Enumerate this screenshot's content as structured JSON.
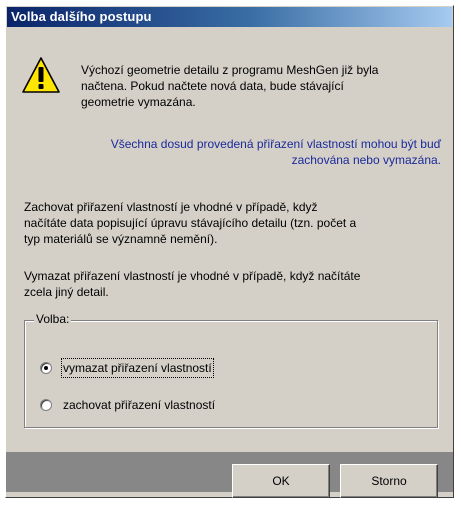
{
  "window": {
    "title": "Volba dalšího postupu"
  },
  "icons": {
    "warning": "warning-icon"
  },
  "messages": {
    "intro_line1": "Výchozí geometrie detailu z programu MeshGen již byla",
    "intro_line2": "načtena. Pokud načtete nová data, bude stávající",
    "intro_line3": "geometrie vymazána.",
    "info_line1": "Všechna dosud provedená přiřazení vlastností mohou být buď",
    "info_line2": "zachována nebo vymazána.",
    "keep_line1": "Zachovat přiřazení vlastností je vhodné v případě, když",
    "keep_line2": "načítáte data popisující úpravu stávajícího detailu (tzn. počet a",
    "keep_line3": "typ materiálů se významně nemění).",
    "delete_line1": "Vymazat přiřazení vlastností je vhodné v případě, když načítáte",
    "delete_line2": "zcela jiný detail."
  },
  "choice_group": {
    "legend": "Volba:",
    "options": [
      {
        "label": "vymazat přiřazení vlastností",
        "selected": true
      },
      {
        "label": "zachovat přiřazení vlastností",
        "selected": false
      }
    ]
  },
  "buttons": {
    "ok": "OK",
    "cancel": "Storno"
  },
  "colors": {
    "info_text": "#1a2a9a",
    "face": "#d4d0c8",
    "bottom_bar": "#878787"
  }
}
